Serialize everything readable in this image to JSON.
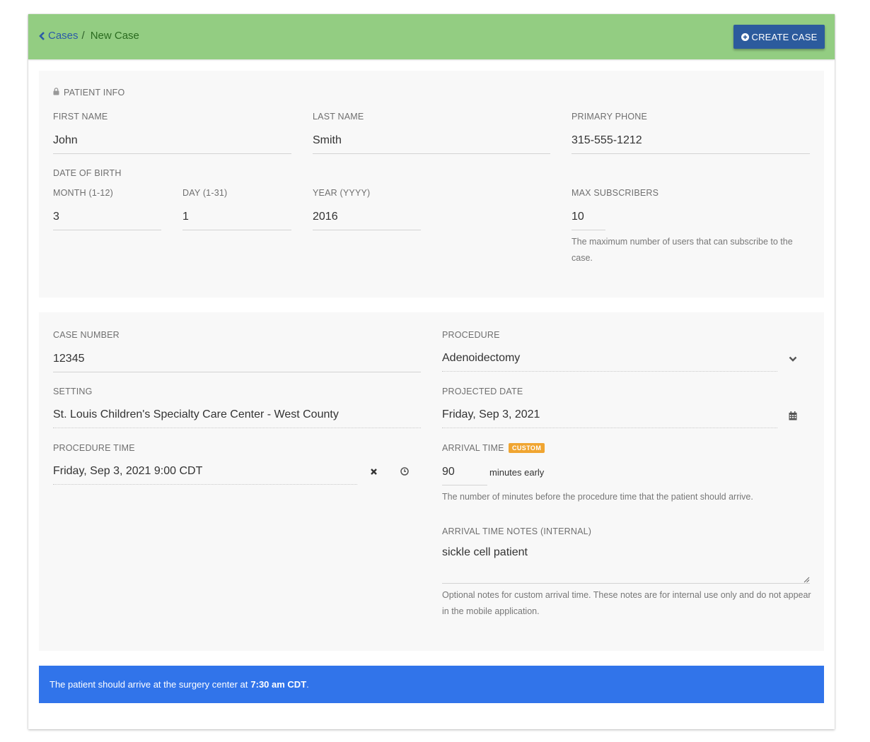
{
  "header": {
    "breadcrumb_parent": "Cases",
    "breadcrumb_separator": "/",
    "breadcrumb_current": "New Case",
    "create_button_label": "CREATE CASE"
  },
  "patient_info": {
    "section_title": "PATIENT INFO",
    "first_name": {
      "label": "FIRST NAME",
      "value": "John"
    },
    "last_name": {
      "label": "LAST NAME",
      "value": "Smith"
    },
    "primary_phone": {
      "label": "PRIMARY PHONE",
      "value": "315-555-1212"
    },
    "dob_label": "DATE OF BIRTH",
    "month": {
      "label": "MONTH (1-12)",
      "value": "3"
    },
    "day": {
      "label": "DAY (1-31)",
      "value": "1"
    },
    "year": {
      "label": "YEAR (YYYY)",
      "value": "2016"
    },
    "max_subscribers": {
      "label": "MAX SUBSCRIBERS",
      "value": "10",
      "help": "The maximum number of users that can subscribe to the case."
    }
  },
  "case_info": {
    "case_number": {
      "label": "CASE NUMBER",
      "value": "12345"
    },
    "procedure": {
      "label": "PROCEDURE",
      "value": "Adenoidectomy"
    },
    "setting": {
      "label": "SETTING",
      "value": "St. Louis Children's Specialty Care Center - West County"
    },
    "projected_date": {
      "label": "PROJECTED DATE",
      "value": "Friday, Sep 3, 2021"
    },
    "procedure_time": {
      "label": "PROCEDURE TIME",
      "value": "Friday, Sep 3, 2021 9:00 CDT"
    },
    "arrival_time": {
      "label": "ARRIVAL TIME",
      "badge": "CUSTOM",
      "value": "90",
      "suffix": "minutes early",
      "help": "The number of minutes before the procedure time that the patient should arrive."
    },
    "arrival_notes": {
      "label": "ARRIVAL TIME NOTES (INTERNAL)",
      "value": "sickle cell patient",
      "help": "Optional notes for custom arrival time. These notes are for internal use only and do not appear in the mobile application."
    }
  },
  "alert": {
    "text": "The patient should arrive at the surgery center at",
    "time": "7:30 am CDT",
    "end": "."
  },
  "colors": {
    "header_bg": "#93cd82",
    "button_bg": "#2c5b9d",
    "alert_bg": "#3174ea",
    "badge_bg": "#f0a531"
  }
}
